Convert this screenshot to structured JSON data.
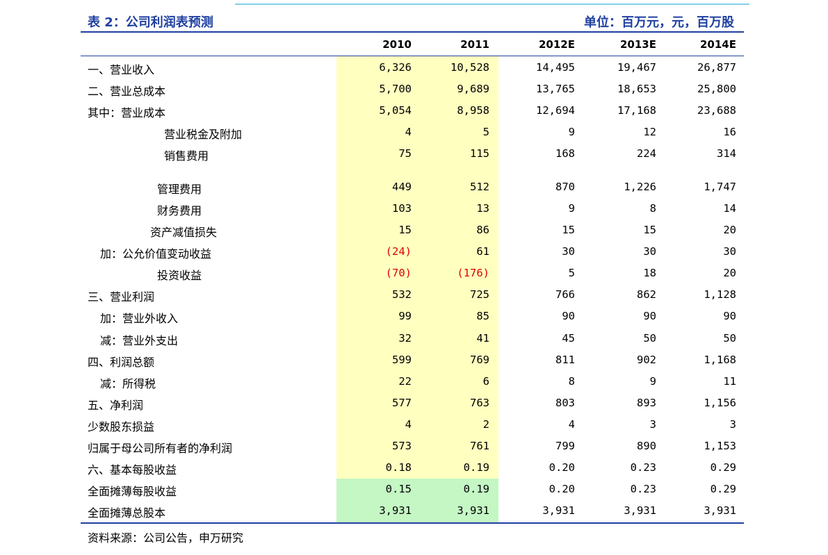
{
  "title": "表 2：公司利润表预测",
  "unit": "单位：百万元，元，百万股",
  "columns": [
    "2010",
    "2011",
    "2012E",
    "2013E",
    "2014E"
  ],
  "rows": [
    {
      "label": "一、营业收入",
      "indent": 0,
      "values": [
        "6,326",
        "10,528",
        "14,495",
        "19,467",
        "26,877"
      ]
    },
    {
      "label": "二、营业总成本",
      "indent": 0,
      "values": [
        "5,700",
        "9,689",
        "13,765",
        "18,653",
        "25,800"
      ]
    },
    {
      "label": "其中：营业成本",
      "indent": 0,
      "values": [
        "5,054",
        "8,958",
        "12,694",
        "17,168",
        "23,688"
      ]
    },
    {
      "label": "营业税金及附加",
      "indent": 110,
      "values": [
        "4",
        "5",
        "9",
        "12",
        "16"
      ]
    },
    {
      "label": "销售费用",
      "indent": 110,
      "values": [
        "75",
        "115",
        "168",
        "224",
        "314"
      ]
    },
    {
      "label": "管理费用",
      "indent": 100,
      "values": [
        "449",
        "512",
        "870",
        "1,226",
        "1,747"
      ]
    },
    {
      "label": "财务费用",
      "indent": 100,
      "values": [
        "103",
        "13",
        "9",
        "8",
        "14"
      ]
    },
    {
      "label": "资产减值损失",
      "indent": 90,
      "values": [
        "15",
        "86",
        "15",
        "15",
        "20"
      ]
    },
    {
      "label": "加：公允价值变动收益",
      "indent": 18,
      "values": [
        "(24)",
        "61",
        "30",
        "30",
        "30"
      ]
    },
    {
      "label": "投资收益",
      "indent": 100,
      "values": [
        "(70)",
        "(176)",
        "5",
        "18",
        "20"
      ]
    },
    {
      "label": "三、营业利润",
      "indent": 0,
      "values": [
        "532",
        "725",
        "766",
        "862",
        "1,128"
      ]
    },
    {
      "label": "加：营业外收入",
      "indent": 18,
      "values": [
        "99",
        "85",
        "90",
        "90",
        "90"
      ]
    },
    {
      "label": "减：营业外支出",
      "indent": 18,
      "values": [
        "32",
        "41",
        "45",
        "50",
        "50"
      ]
    },
    {
      "label": "四、利润总额",
      "indent": 0,
      "values": [
        "599",
        "769",
        "811",
        "902",
        "1,168"
      ]
    },
    {
      "label": "减：所得税",
      "indent": 18,
      "values": [
        "22",
        "6",
        "8",
        "9",
        "11"
      ]
    },
    {
      "label": "五、净利润",
      "indent": 0,
      "values": [
        "577",
        "763",
        "803",
        "893",
        "1,156"
      ]
    },
    {
      "label": "少数股东损益",
      "indent": 0,
      "values": [
        "4",
        "2",
        "4",
        "3",
        "3"
      ]
    },
    {
      "label": "归属于母公司所有者的净利润",
      "indent": 0,
      "values": [
        "573",
        "761",
        "799",
        "890",
        "1,153"
      ]
    },
    {
      "label": "六、基本每股收益",
      "indent": 0,
      "values": [
        "0.18",
        "0.19",
        "0.20",
        "0.23",
        "0.29"
      ]
    },
    {
      "label": "全面摊薄每股收益",
      "indent": 0,
      "values": [
        "0.15",
        "0.19",
        "0.20",
        "0.23",
        "0.29"
      ]
    },
    {
      "label": "全面摊薄总股本",
      "indent": 0,
      "values": [
        "3,931",
        "3,931",
        "3,931",
        "3,931",
        "3,931"
      ]
    }
  ],
  "source": "资料来源：公司公告，申万研究",
  "colors": {
    "title": "#1f3fa0",
    "negative": "#e00000",
    "highlight_yellow": "#ffffc0",
    "highlight_green": "#c4f7c4"
  }
}
